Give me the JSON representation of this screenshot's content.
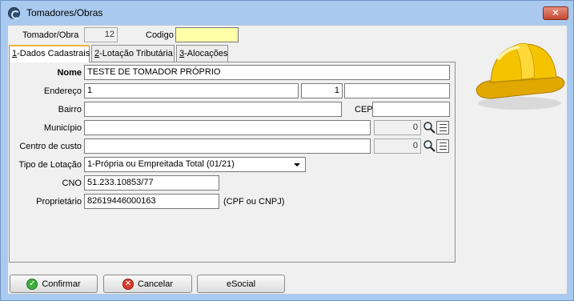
{
  "window": {
    "title": "Tomadores/Obras",
    "close_glyph": "✕"
  },
  "header": {
    "tomador_label": "Tomador/Obra",
    "tomador_value": "12",
    "codigo_label": "Codigo",
    "codigo_value": ""
  },
  "tabs": [
    {
      "hotkey": "1",
      "label": "-Dados Cadastrais",
      "active": true
    },
    {
      "hotkey": "2",
      "label": "-Lotação Tributária",
      "active": false
    },
    {
      "hotkey": "3",
      "label": "-Alocações",
      "active": false
    }
  ],
  "form": {
    "nome_label": "Nome",
    "nome_value": "TESTE DE TOMADOR PRÓPRIO",
    "endereco_label": "Endereço",
    "endereco_value": "1",
    "numero_value": "1",
    "complemento_value": "",
    "bairro_label": "Bairro",
    "bairro_value": "",
    "cep_label": "CEP",
    "cep_value": "",
    "municipio_label": "Município",
    "municipio_value": "",
    "municipio_code": "0",
    "centro_label": "Centro de custo",
    "centro_value": "",
    "centro_code": "0",
    "lotacao_label": "Tipo de Lotação",
    "lotacao_value": "1-Própria ou Empreitada Total (01/21)",
    "cno_label": "CNO",
    "cno_value": "51.233.10853/77",
    "proprietario_label": "Proprietário",
    "proprietario_value": "82619446000163",
    "proprietario_hint": "(CPF ou CNPJ)"
  },
  "buttons": {
    "confirmar": "Confirmar",
    "cancelar": "Cancelar",
    "esocial": "eSocial"
  },
  "icons": {
    "app": "app-icon",
    "lookup": "magnifier-icon",
    "list": "list-icon",
    "confirm": "check-icon",
    "cancel": "x-icon",
    "logo": "hard-hat-icon"
  },
  "colors": {
    "title_bar": "#a9c9ef",
    "codigo_field": "#ffffa8",
    "helmet": "#f5c400"
  }
}
